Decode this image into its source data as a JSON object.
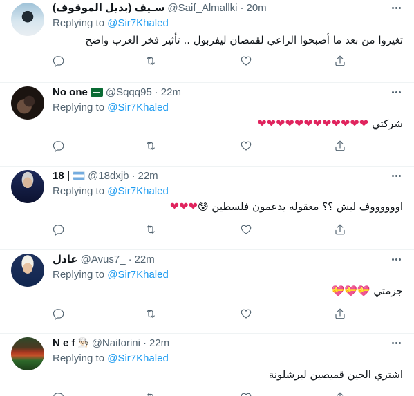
{
  "reply_prefix": "Replying to",
  "reply_target": "@Sir7Khaled",
  "dot": "·",
  "tweets": [
    {
      "name": "سـيف (بديل الموقوف)",
      "handle": "@Saif_Almallki",
      "time": "20m",
      "flag": "",
      "emoji": "",
      "text": "تغيروا من بعد ما أصبحوا الراعي لقمصان ليفربول .. تأثير فخر العرب واضح"
    },
    {
      "name": "No one",
      "handle": "@Sqqq95",
      "time": "22m",
      "flag": "saudi-flag",
      "emoji": "",
      "text": "شركتي ❤❤❤❤❤❤❤❤❤❤❤❤"
    },
    {
      "name": "18 |",
      "handle": "@18dxjb",
      "time": "22m",
      "flag": "argentina-flag",
      "emoji": "",
      "text": "اووووووف ليش ؟؟ معقوله يدعمون فلسطين 😰❤❤❤"
    },
    {
      "name": "عادل",
      "handle": "@Avus7_",
      "time": "22m",
      "flag": "",
      "emoji": "",
      "text": "جزمتي 💝💝💝"
    },
    {
      "name": "N e f",
      "handle": "@Naiforini",
      "time": "22m",
      "flag": "",
      "emoji": "👨🏻‍🍳",
      "text": "اشتري الحين قميصين لبرشلونة"
    }
  ]
}
